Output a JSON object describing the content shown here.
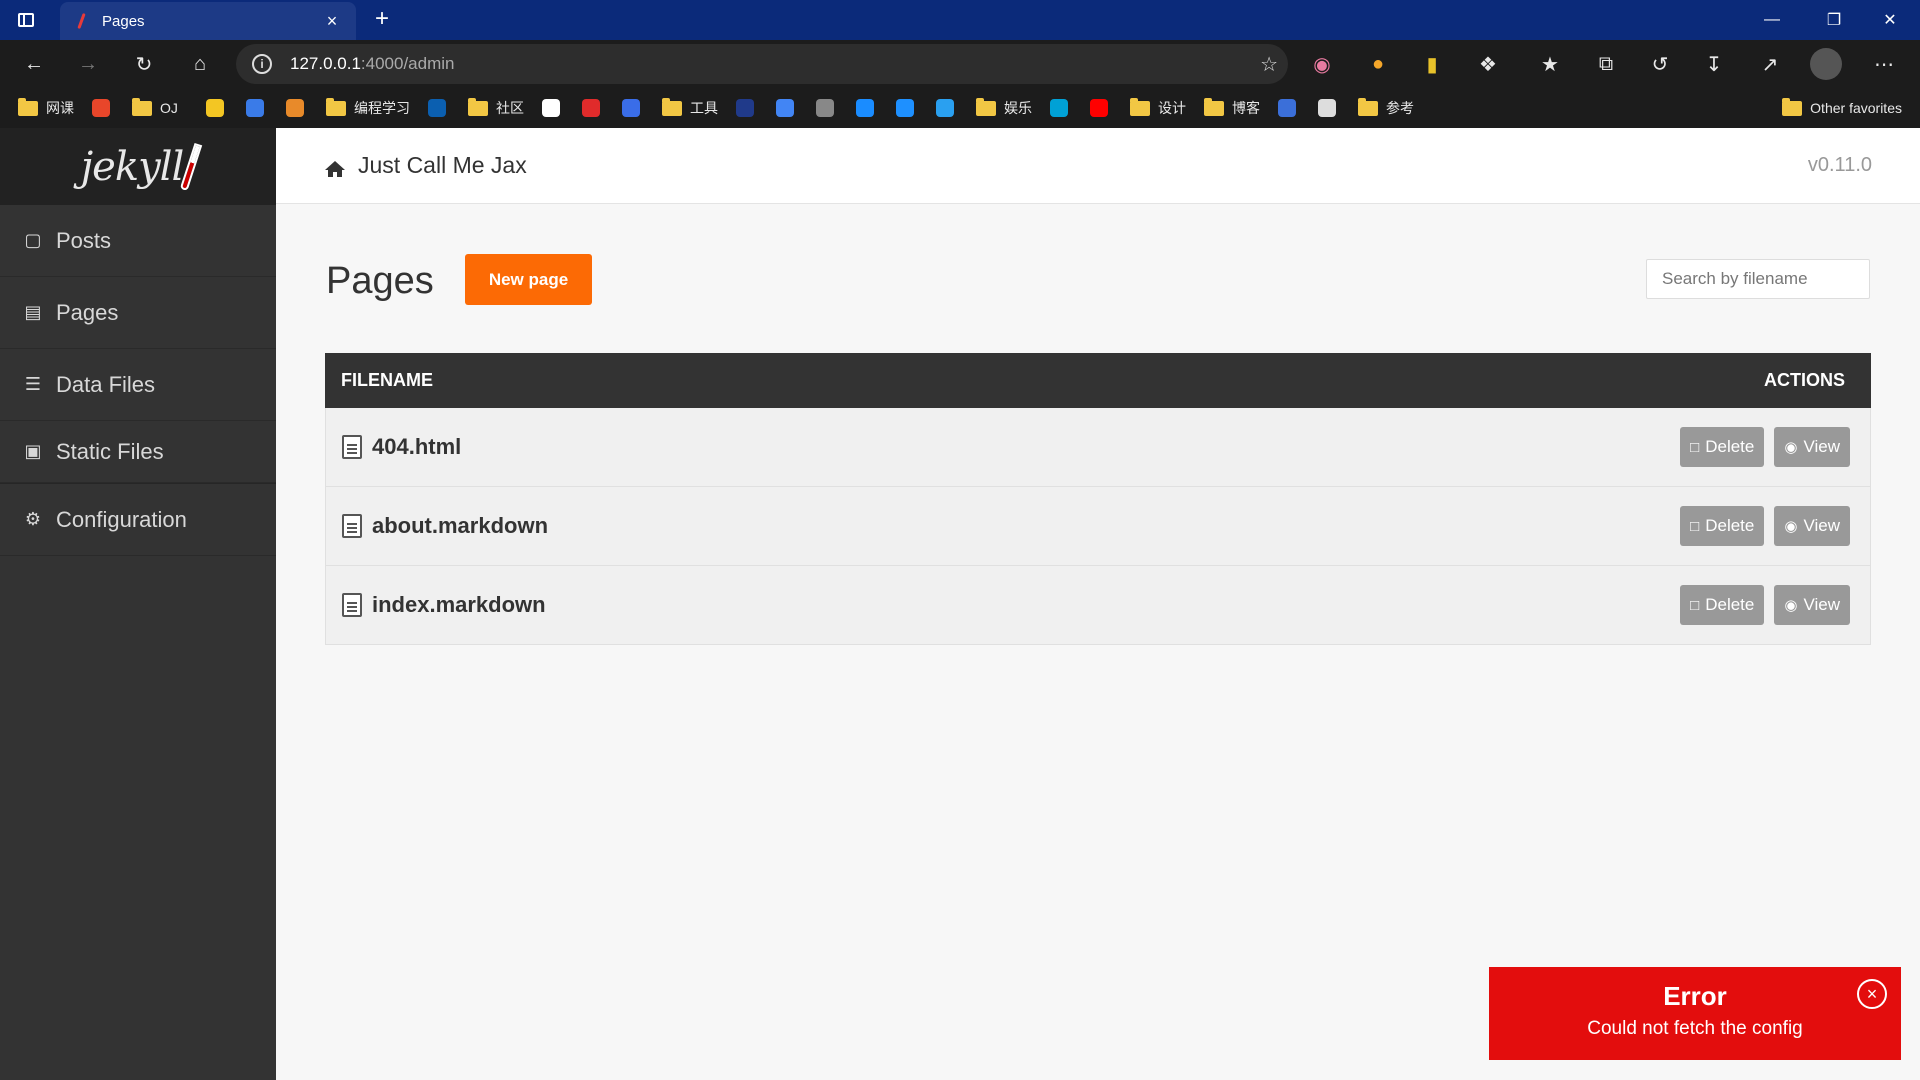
{
  "browser": {
    "tab_title": "Pages",
    "tab_close": "×",
    "new_tab": "+",
    "address_host": "127.0.0.1",
    "address_path": ":4000/admin",
    "window_controls": {
      "minimize": "—",
      "restore": "❐",
      "close": "✕"
    },
    "toolbar_icons": [
      "back-icon",
      "forward-icon",
      "refresh-icon",
      "home-icon"
    ],
    "bookmarks": [
      {
        "label": "网课",
        "type": "folder"
      },
      {
        "label": "",
        "type": "site",
        "color": "#e8462a"
      },
      {
        "label": "OJ",
        "type": "folder"
      },
      {
        "label": "",
        "type": "site",
        "color": "#f3c623"
      },
      {
        "label": "",
        "type": "site",
        "color": "#3a7be8"
      },
      {
        "label": "",
        "type": "site",
        "color": "#e88a2a"
      },
      {
        "label": "编程学习",
        "type": "folder"
      },
      {
        "label": "",
        "type": "site",
        "color": "#0b5fb0"
      },
      {
        "label": "社区",
        "type": "folder"
      },
      {
        "label": "",
        "type": "site",
        "color": "#ffffff"
      },
      {
        "label": "",
        "type": "site",
        "color": "#e02b2b"
      },
      {
        "label": "",
        "type": "site",
        "color": "#3a6de8"
      },
      {
        "label": "工具",
        "type": "folder"
      },
      {
        "label": "",
        "type": "site",
        "color": "#203a8a"
      },
      {
        "label": "",
        "type": "site",
        "color": "#4285f4"
      },
      {
        "label": "",
        "type": "site",
        "color": "#888888"
      },
      {
        "label": "",
        "type": "site",
        "color": "#1a8cff"
      },
      {
        "label": "",
        "type": "site",
        "color": "#1e90ff"
      },
      {
        "label": "",
        "type": "site",
        "color": "#2aa0f0"
      },
      {
        "label": "娱乐",
        "type": "folder"
      },
      {
        "label": "",
        "type": "site",
        "color": "#00a1d6"
      },
      {
        "label": "",
        "type": "site",
        "color": "#ff0000"
      },
      {
        "label": "设计",
        "type": "folder"
      },
      {
        "label": "博客",
        "type": "folder"
      },
      {
        "label": "",
        "type": "site",
        "color": "#3b6fd9"
      },
      {
        "label": "",
        "type": "site",
        "color": "#dddddd"
      },
      {
        "label": "参考",
        "type": "folder"
      }
    ],
    "other_favorites": "Other favorites"
  },
  "app": {
    "site_name": "Just Call Me Jax",
    "version": "v0.11.0",
    "logo_text": "jekyll",
    "nav": [
      {
        "label": "Posts",
        "icon": "book-icon"
      },
      {
        "label": "Pages",
        "icon": "file-icon"
      },
      {
        "label": "Data Files",
        "icon": "database-icon"
      },
      {
        "label": "Static Files",
        "icon": "file-icon"
      },
      {
        "label": "Configuration",
        "icon": "gear-icon"
      }
    ],
    "page_title": "Pages",
    "new_button": "New page",
    "search_placeholder": "Search by filename",
    "table": {
      "col_filename": "FILENAME",
      "col_actions": "ACTIONS",
      "delete_label": "Delete",
      "view_label": "View",
      "rows": [
        "404.html",
        "about.markdown",
        "index.markdown"
      ]
    },
    "toast": {
      "title": "Error",
      "message": "Could not fetch the config",
      "close": "×"
    }
  },
  "colors": {
    "accent": "#fc6a05",
    "sidebar": "#333333",
    "error": "#e30d0d"
  }
}
